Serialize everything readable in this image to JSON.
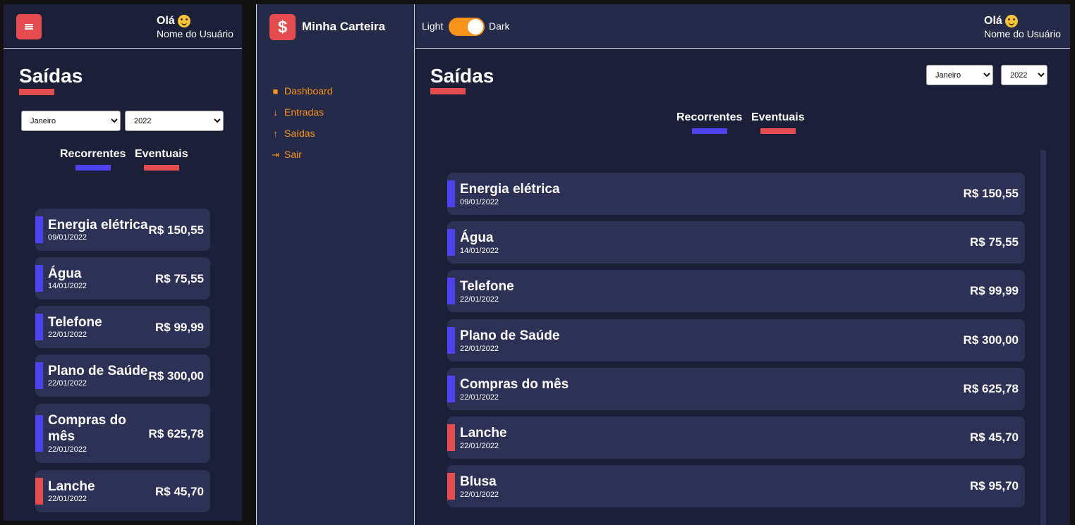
{
  "mobile": {
    "greeting": "Olá",
    "username": "Nome do Usuário",
    "title": "Saídas",
    "month_select": "Janeiro",
    "year_select": "2022",
    "tabs": [
      "Recorrentes",
      "Eventuais"
    ],
    "items": [
      {
        "name": "Energia elétrica",
        "date": "09/01/2022",
        "amount": "R$ 150,55",
        "tag": "recurrent"
      },
      {
        "name": "Água",
        "date": "14/01/2022",
        "amount": "R$ 75,55",
        "tag": "recurrent"
      },
      {
        "name": "Telefone",
        "date": "22/01/2022",
        "amount": "R$ 99,99",
        "tag": "recurrent"
      },
      {
        "name": "Plano de Saúde",
        "date": "22/01/2022",
        "amount": "R$ 300,00",
        "tag": "recurrent"
      },
      {
        "name": "Compras do mês",
        "date": "22/01/2022",
        "amount": "R$ 625,78",
        "tag": "recurrent"
      },
      {
        "name": "Lanche",
        "date": "22/01/2022",
        "amount": "R$ 45,70",
        "tag": "eventual"
      }
    ]
  },
  "desktop": {
    "logo_symbol": "$",
    "app_name": "Minha Carteira",
    "nav": [
      {
        "label": "Dashboard",
        "icon": "dashboard-icon"
      },
      {
        "label": "Entradas",
        "icon": "arrow-down-icon"
      },
      {
        "label": "Saídas",
        "icon": "arrow-up-icon"
      },
      {
        "label": "Sair",
        "icon": "logout-icon"
      }
    ],
    "theme_light": "Light",
    "theme_dark": "Dark",
    "greeting": "Olá",
    "username": "Nome do Usuário",
    "title": "Saídas",
    "month_select": "Janeiro",
    "year_select": "2022",
    "tabs": [
      "Recorrentes",
      "Eventuais"
    ],
    "items": [
      {
        "name": "Energia elétrica",
        "date": "09/01/2022",
        "amount": "R$ 150,55",
        "tag": "recurrent"
      },
      {
        "name": "Água",
        "date": "14/01/2022",
        "amount": "R$ 75,55",
        "tag": "recurrent"
      },
      {
        "name": "Telefone",
        "date": "22/01/2022",
        "amount": "R$ 99,99",
        "tag": "recurrent"
      },
      {
        "name": "Plano de Saúde",
        "date": "22/01/2022",
        "amount": "R$ 300,00",
        "tag": "recurrent"
      },
      {
        "name": "Compras do mês",
        "date": "22/01/2022",
        "amount": "R$ 625,78",
        "tag": "recurrent"
      },
      {
        "name": "Lanche",
        "date": "22/01/2022",
        "amount": "R$ 45,70",
        "tag": "eventual"
      },
      {
        "name": "Blusa",
        "date": "22/01/2022",
        "amount": "R$ 95,70",
        "tag": "eventual"
      }
    ]
  },
  "colors": {
    "recurrent": "#4e41f0",
    "eventual": "#e44c4e",
    "accent": "#f7931b",
    "card": "#2c3155",
    "background": "#1b1f38"
  }
}
